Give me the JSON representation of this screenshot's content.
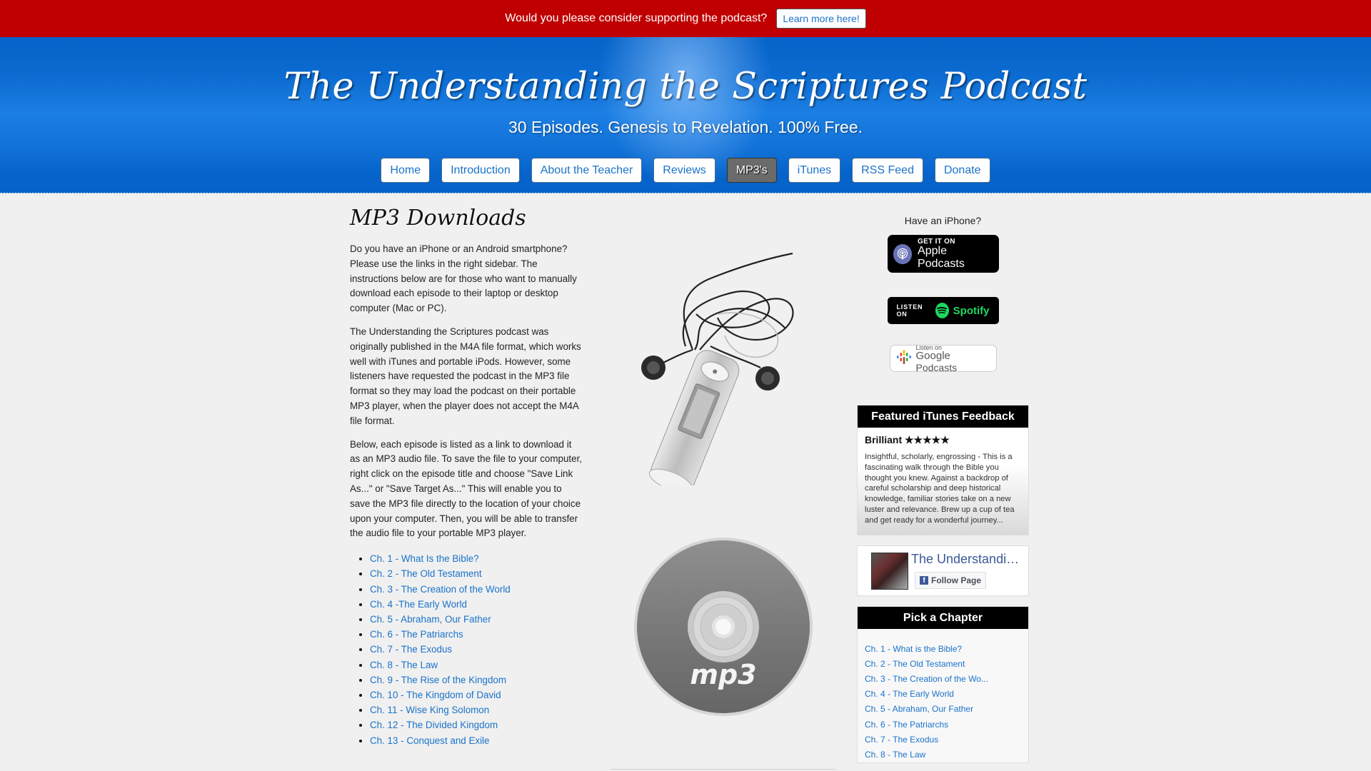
{
  "support_bar": {
    "message": "Would you please consider supporting the podcast?",
    "button_label": "Learn more here!"
  },
  "header": {
    "title": "The Understanding the Scriptures Podcast",
    "tagline": "30 Episodes. Genesis to Revelation. 100% Free."
  },
  "nav": {
    "items": [
      {
        "label": "Home"
      },
      {
        "label": "Introduction"
      },
      {
        "label": "About the Teacher"
      },
      {
        "label": "Reviews"
      },
      {
        "label": "MP3's"
      },
      {
        "label": "iTunes"
      },
      {
        "label": "RSS Feed"
      },
      {
        "label": "Donate"
      }
    ],
    "active": "MP3's"
  },
  "main": {
    "title": "MP3 Downloads",
    "paragraphs": [
      "Do you have an iPhone or an Android smartphone? Please use the links in the right sidebar. The instructions below are for those who want to manually download each episode to their laptop or desktop computer (Mac or PC).",
      "The Understanding the Scriptures podcast was originally published in the M4A file format, which works well with iTunes and portable iPods. However, some listeners have requested the podcast in the MP3 file format so they may load the podcast on their portable MP3 player, when the player does not accept the M4A file format.",
      "Below, each episode is listed as a link to download it as an MP3 audio file. To save the file to your computer, right click on the episode title and choose \"Save Link As...\" or \"Save Target As...\" This will enable you to save the MP3 file directly to the location of your choice upon your computer. Then, you will be able to transfer the audio file to your portable MP3 player."
    ],
    "episodes": [
      "Ch. 1 - What Is the Bible?",
      "Ch. 2 - The Old Testament",
      "Ch. 3 - The Creation of the World",
      "Ch. 4 -The Early World",
      "Ch. 5 - Abraham, Our Father",
      "Ch. 6 - The Patriarchs",
      "Ch. 7 - The Exodus",
      "Ch. 8 - The Law",
      "Ch. 9 - The Rise of the Kingdom",
      "Ch. 10 - The Kingdom of David",
      "Ch. 11 - Wise King Solomon",
      "Ch. 12 - The Divided Kingdom",
      "Ch. 13 - Conquest and Exile"
    ]
  },
  "images": {
    "cd_label": "mp3"
  },
  "sidebar": {
    "have_iphone": "Have an iPhone?",
    "apple_badge": {
      "small": "GET IT ON",
      "big_1": "Apple",
      "big_2": "Podcasts"
    },
    "spotify_badge": {
      "small": "LISTEN ON",
      "brand": "Spotify"
    },
    "google_badge": {
      "small": "Listen on",
      "big_1": "Google",
      "big_2": "Podcasts"
    },
    "feedback": {
      "heading": "Featured iTunes Feedback",
      "title": "Brilliant ★★★★★",
      "text": "Insightful, scholarly, engrossing - This is a fascinating walk through the Bible you thought you knew. Against a backdrop of careful scholarship and deep historical knowledge, familiar stories take on a new luster and relevance. Brew up a cup of tea and get ready for a wonderful journey..."
    },
    "facebook": {
      "page_name": "The Understanding the Scriptures Podcast",
      "follow_label": "Follow Page"
    },
    "chapters": {
      "heading": "Pick a Chapter",
      "items": [
        "Ch. 1 - What is the Bible?",
        "Ch. 2 - The Old Testament",
        "Ch. 3 - The Creation of the Wo...",
        "Ch. 4 - The Early World",
        "Ch. 5 - Abraham, Our Father",
        "Ch. 6 - The Patriarchs",
        "Ch. 7 - The Exodus",
        "Ch. 8 - The Law"
      ]
    }
  },
  "colors": {
    "support_red": "#c00000",
    "header_blue": "#0c6bd0",
    "link_blue": "#1a73c9",
    "active_nav": "#6b6b6b",
    "spotify_green": "#1ed760"
  }
}
